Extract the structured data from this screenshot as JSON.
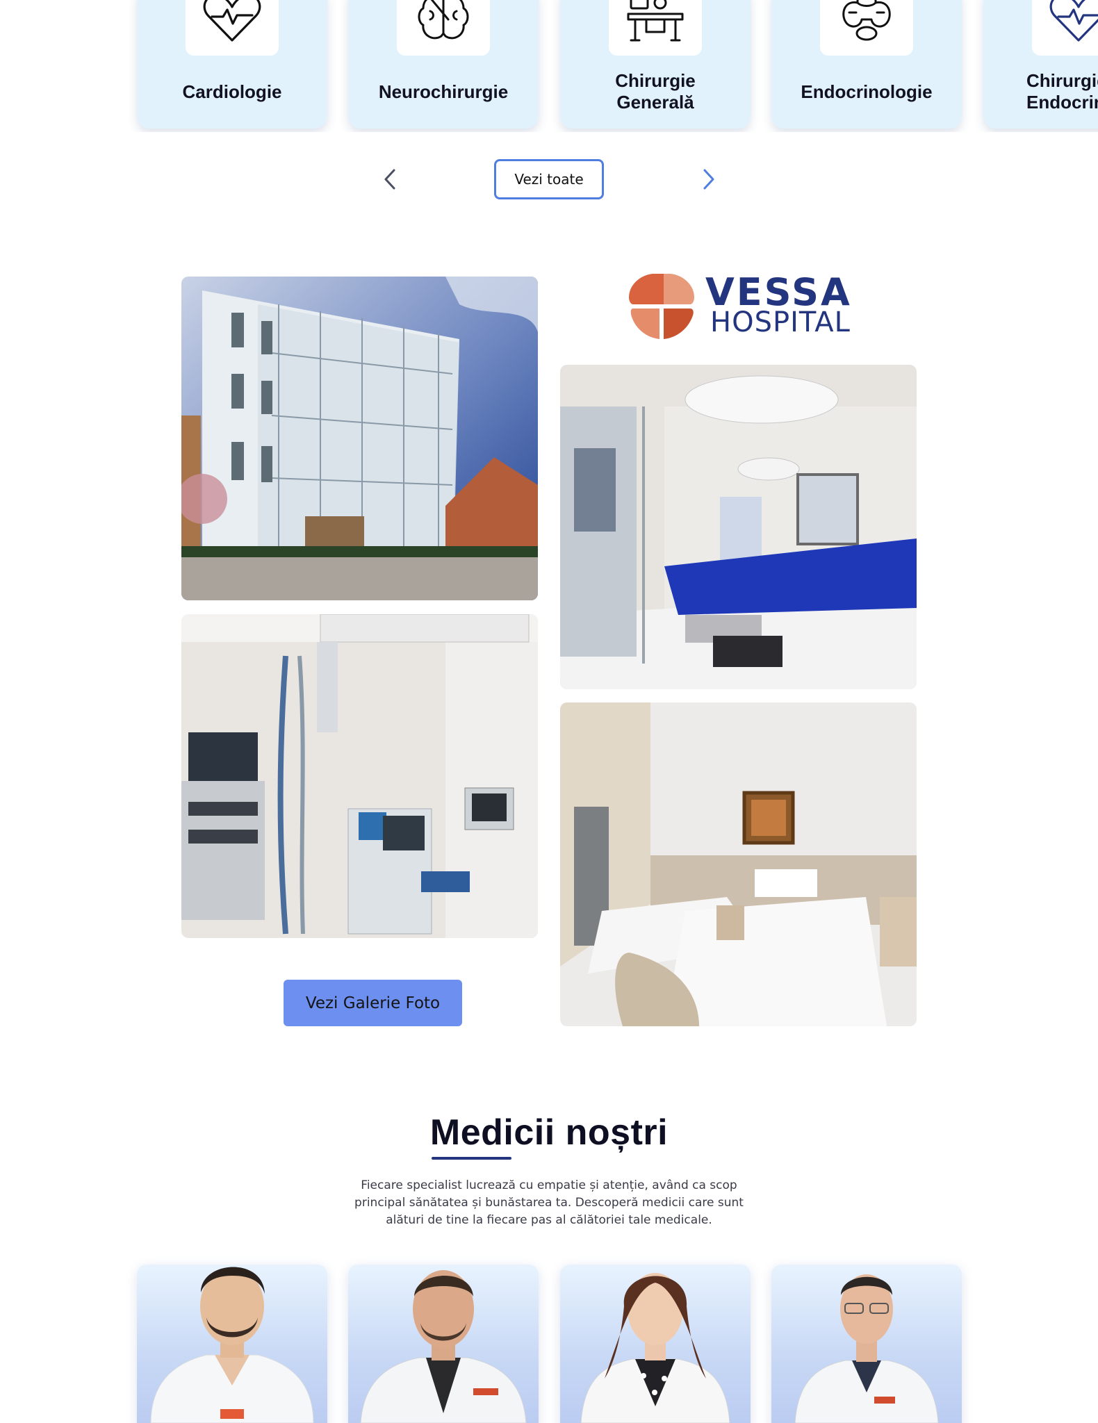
{
  "specialties": {
    "items": [
      {
        "name": "Cardiologie",
        "icon": "heart-pulse-icon"
      },
      {
        "name": "Neurochirurgie",
        "icon": "brain-scalpel-icon"
      },
      {
        "name": "Chirurgie\nGenerală",
        "icon": "operating-table-icon"
      },
      {
        "name": "Endocrinologie",
        "icon": "thyroid-icon"
      },
      {
        "name": "Chirurgie\nEndocrin",
        "icon": "heart-pulse-icon"
      }
    ],
    "view_all_label": "Vezi toate",
    "prev_icon": "chevron-left-icon",
    "next_icon": "chevron-right-icon"
  },
  "gallery": {
    "logo": {
      "word1": "VESSA",
      "word2": "HOSPITAL"
    },
    "button_label": "Vezi Galerie Foto"
  },
  "doctors": {
    "title": "Medicii noștri",
    "intro": "Fiecare specialist lucrează cu empatie și atenție, având ca scop principal sănătatea și bunăstarea ta. Descoperă medicii care sunt alături de tine la fiecare pas al călătoriei tale medicale."
  },
  "colors": {
    "brand_navy": "#23357f",
    "accent_blue": "#4f7de0",
    "button_blue": "#6d8ff0",
    "card_light_blue": "#e1f2fd",
    "logo_orange": "#d9633f"
  }
}
